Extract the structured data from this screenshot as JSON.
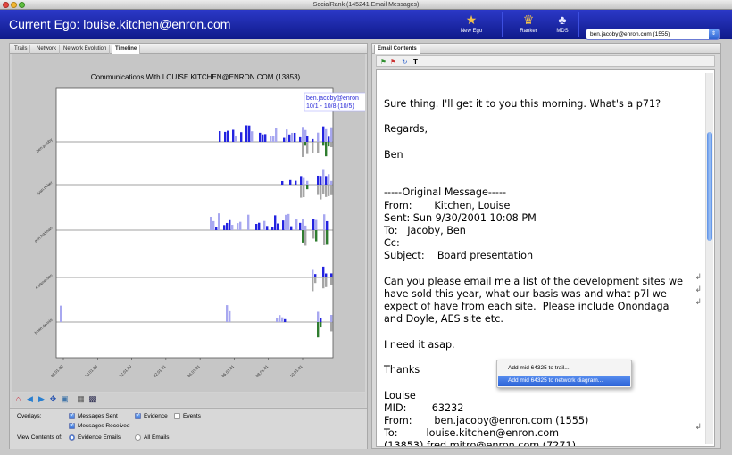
{
  "window": {
    "title": "SocialRank (145241 Email Messages)"
  },
  "header": {
    "ego_label": "Current Ego: louise.kitchen@enron.com",
    "tools": [
      {
        "label": "New Ego",
        "icon": "person-star-icon"
      },
      {
        "label": "Ranker",
        "icon": "ranker-icon"
      },
      {
        "label": "MDS",
        "icon": "mds-icon"
      }
    ],
    "ego_select": {
      "value": "ben.jacoby@enron.com (1555)"
    }
  },
  "left_tabs": [
    "Trails",
    "Network",
    "Network Evolution",
    "Timeline"
  ],
  "left_tab_active": "Timeline",
  "timeline": {
    "title": "Communications With LOUISE.KITCHEN@ENRON.COM (13853)",
    "tooltip": {
      "line1": "ben.jacoby@enron",
      "line2": "10/1 - 10/8 (10/5)"
    },
    "rows": [
      "ben.jacoby",
      "ryan.m.ker",
      "ann.feldman",
      "e.stenerson",
      "brian.dennis"
    ],
    "date_ticks": [
      "08.01.00",
      "10.01.00",
      "12.01.00",
      "02.01.01",
      "04.01.01",
      "06.01.01",
      "08.01.01",
      "10.01.01"
    ]
  },
  "overlays": {
    "label": "Overlays:",
    "messages_sent": "Messages Sent",
    "evidence": "Evidence",
    "events": "Events",
    "messages_received": "Messages Received",
    "view_label": "View Contents of:",
    "evidence_emails": "Evidence Emails",
    "all_emails": "All Emails"
  },
  "email": {
    "tab": "Email Contents",
    "body": "Sure thing. I'll get it to you this morning. What's a p71?\n\nRegards,\n\nBen\n\n\n-----Original Message-----\nFrom:       Kitchen, Louise\nSent: Sun 9/30/2001 10:08 PM\nTo:   Jacoby, Ben\nCc:\nSubject:    Board presentation\n\nCan you please email me a list of the development sites we\nhave sold this year, what our basis was and what p7l we\nexpect of have from each site.  Please include Onondaga\nand Doyle, AES site etc.\n\nI need it asap.\n\nThanks\n\nLouise\nMID:        63232\nFrom:       ben.jacoby@enron.com (1555)\nTo:         louise.kitchen@enron.com\n(13853),fred.mitro@enron.com (7271)"
  },
  "context_menu": {
    "items": [
      "Add mid 64325 to trail...",
      "Add mid 64325 to network diagram..."
    ],
    "highlighted": 1
  },
  "colors": {
    "header": "#1a26a8",
    "sent": "#2323e0",
    "received": "#a8a8f0",
    "evidence": "#2f7d2f",
    "grey_bar": "#a6a6a6"
  }
}
